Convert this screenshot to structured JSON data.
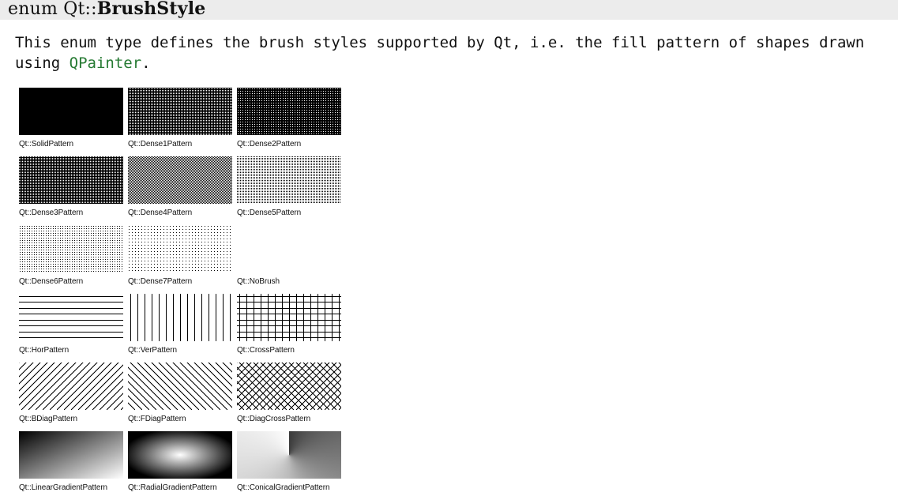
{
  "heading": {
    "prefix": "enum Qt::",
    "name": "BrushStyle"
  },
  "description": {
    "text": "This enum type defines the brush styles supported by Qt, i.e. the fill pattern of shapes drawn using",
    "link": "QPainter",
    "suffix": "."
  },
  "colors": {
    "heading_background": "#ececec",
    "link": "#267a33",
    "pattern": "#000000",
    "background": "#ffffff"
  },
  "brush_styles": [
    {
      "label": "Qt::SolidPattern",
      "pattern": "solid"
    },
    {
      "label": "Qt::Dense1Pattern",
      "pattern": "dense1"
    },
    {
      "label": "Qt::Dense2Pattern",
      "pattern": "dense2"
    },
    {
      "label": "Qt::Dense3Pattern",
      "pattern": "dense3"
    },
    {
      "label": "Qt::Dense4Pattern",
      "pattern": "dense4"
    },
    {
      "label": "Qt::Dense5Pattern",
      "pattern": "dense5"
    },
    {
      "label": "Qt::Dense6Pattern",
      "pattern": "dense6"
    },
    {
      "label": "Qt::Dense7Pattern",
      "pattern": "dense7"
    },
    {
      "label": "Qt::NoBrush",
      "pattern": "none"
    },
    {
      "label": "Qt::HorPattern",
      "pattern": "hor"
    },
    {
      "label": "Qt::VerPattern",
      "pattern": "ver"
    },
    {
      "label": "Qt::CrossPattern",
      "pattern": "cross"
    },
    {
      "label": "Qt::BDiagPattern",
      "pattern": "bdiag"
    },
    {
      "label": "Qt::FDiagPattern",
      "pattern": "fdiag"
    },
    {
      "label": "Qt::DiagCrossPattern",
      "pattern": "diagcross"
    },
    {
      "label": "Qt::LinearGradientPattern",
      "pattern": "linear"
    },
    {
      "label": "Qt::RadialGradientPattern",
      "pattern": "radial"
    },
    {
      "label": "Qt::ConicalGradientPattern",
      "pattern": "conical"
    }
  ]
}
